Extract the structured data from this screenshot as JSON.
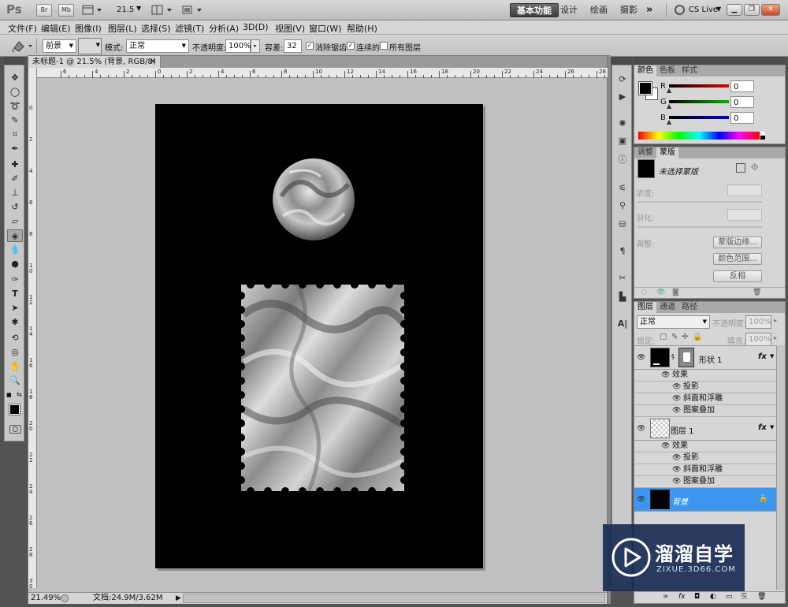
{
  "app": {
    "logo": "Ps",
    "bridge": "Br",
    "minibridge": "Mb",
    "zoom": "21.5"
  },
  "workspaces": [
    "基本功能",
    "设计",
    "绘画",
    "摄影"
  ],
  "cs_live": "CS Live",
  "menu": [
    "文件(F)",
    "编辑(E)",
    "图像(I)",
    "图层(L)",
    "选择(S)",
    "滤镜(T)",
    "分析(A)",
    "3D(D)",
    "视图(V)",
    "窗口(W)",
    "帮助(H)"
  ],
  "options": {
    "fill_source": "前景",
    "mode_label": "模式:",
    "mode_value": "正常",
    "opacity_label": "不透明度:",
    "opacity_value": "100%",
    "tolerance_label": "容差:",
    "tolerance_value": "32",
    "antialias": "消除锯齿",
    "contiguous": "连续的",
    "all_layers": "所有图层"
  },
  "document": {
    "tab_title": "未标题-1 @ 21.5% (背景, RGB/8) *",
    "ruler_h": [
      "6",
      "4",
      "2",
      "0",
      "2",
      "4",
      "6",
      "8",
      "10",
      "12",
      "14",
      "16",
      "18",
      "20",
      "22",
      "24",
      "26",
      "28"
    ],
    "ruler_v": [
      "0",
      "2",
      "4",
      "6",
      "8",
      "1 0",
      "1 2",
      "1 4",
      "1 6",
      "1 8",
      "2 0",
      "2 2",
      "2 4",
      "2 6",
      "2 8",
      "3 0"
    ],
    "zoom_status": "21.49%",
    "doc_info": "文档:24.9M/3.62M"
  },
  "color_panel": {
    "tabs": [
      "颜色",
      "色板",
      "样式"
    ],
    "channels": [
      {
        "name": "R",
        "value": "0",
        "color": "#e00000"
      },
      {
        "name": "G",
        "value": "0",
        "color": "#00b400"
      },
      {
        "name": "B",
        "value": "0",
        "color": "#0000d0"
      }
    ]
  },
  "masks_panel": {
    "tabs": [
      "调整",
      "蒙版"
    ],
    "mask_label": "未选择蒙版",
    "density": "浓度:",
    "feather": "羽化:",
    "refine": "调整:",
    "btn_edge": "蒙版边缘...",
    "btn_range": "颜色范围...",
    "btn_invert": "反相"
  },
  "layers_panel": {
    "tabs": [
      "图层",
      "通道",
      "路径"
    ],
    "blend": "正常",
    "opacity_label": "不透明度:",
    "opacity_value": "100%",
    "lock_label": "锁定:",
    "fill_label": "填充:",
    "fill_value": "100%",
    "layers": [
      {
        "name": "形状 1",
        "fx": "fx",
        "effects_label": "效果",
        "effects": [
          "投影",
          "斜面和浮雕",
          "图案叠加"
        ]
      },
      {
        "name": "图层 1",
        "fx": "fx",
        "effects_label": "效果",
        "effects": [
          "投影",
          "斜面和浮雕",
          "图案叠加"
        ]
      },
      {
        "name": "背景"
      }
    ]
  },
  "watermark": {
    "brand": "溜溜自学",
    "url": "ZIXUE.3D66.COM"
  }
}
